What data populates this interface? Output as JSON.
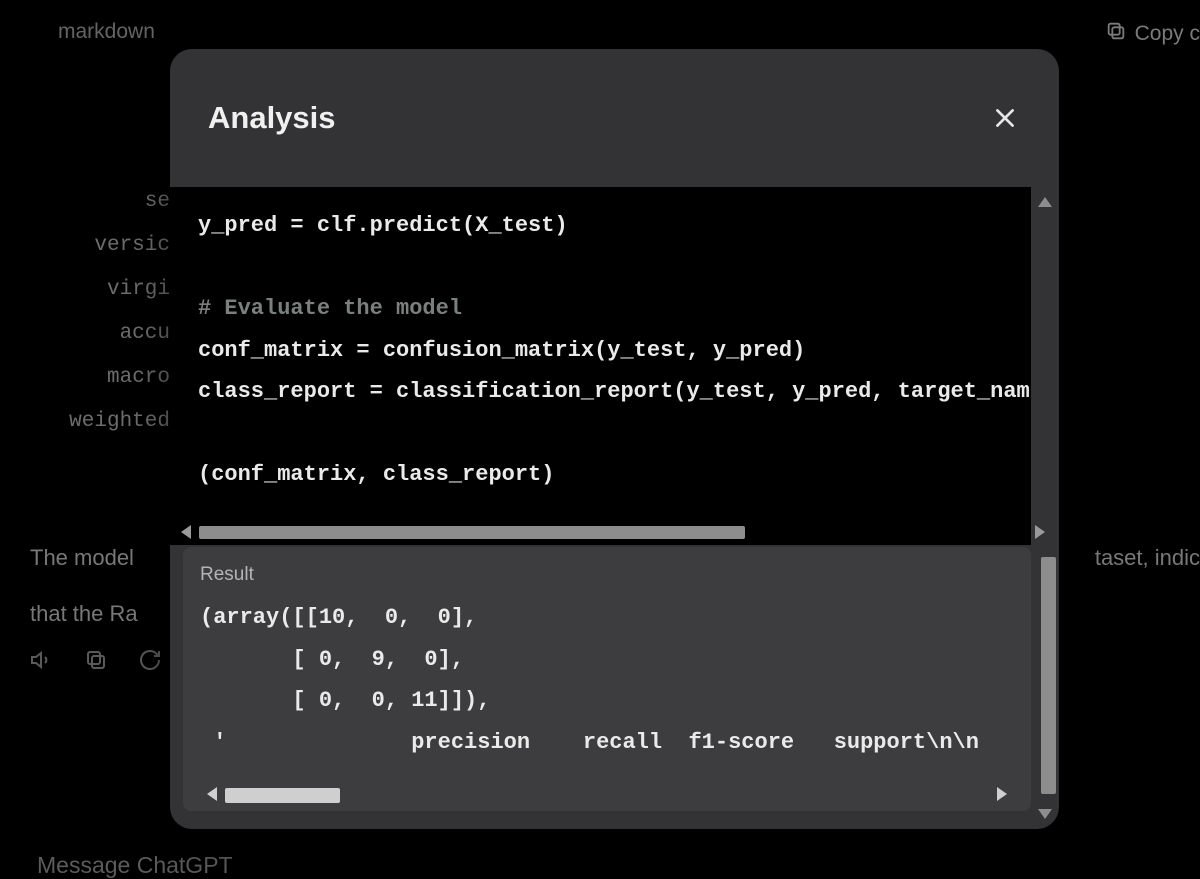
{
  "background": {
    "codeblock_language": "markdown",
    "copy_label": "Copy c",
    "report_labels": [
      "se",
      "versic",
      "virgi",
      "",
      "accu",
      "macro",
      "weighted"
    ],
    "paragraph_line1": "The model",
    "paragraph_line1_right": "taset, indic",
    "paragraph_line2": "that the Ra",
    "message_placeholder": "Message ChatGPT"
  },
  "modal": {
    "title": "Analysis",
    "code_lines": [
      {
        "text": "y_pred = clf.predict(X_test)",
        "type": "code"
      },
      {
        "text": "",
        "type": "code"
      },
      {
        "text": "# Evaluate the model",
        "type": "comment"
      },
      {
        "text": "conf_matrix = confusion_matrix(y_test, y_pred)",
        "type": "code"
      },
      {
        "text": "class_report = classification_report(y_test, y_pred, target_nam",
        "type": "code"
      },
      {
        "text": "",
        "type": "code"
      },
      {
        "text": "(conf_matrix, class_report)",
        "type": "code"
      }
    ],
    "result_label": "Result",
    "result_text": "(array([[10,  0,  0],\n       [ 0,  9,  0],\n       [ 0,  0, 11]]),\n '              precision    recall  f1-score   support\\n\\n"
  }
}
